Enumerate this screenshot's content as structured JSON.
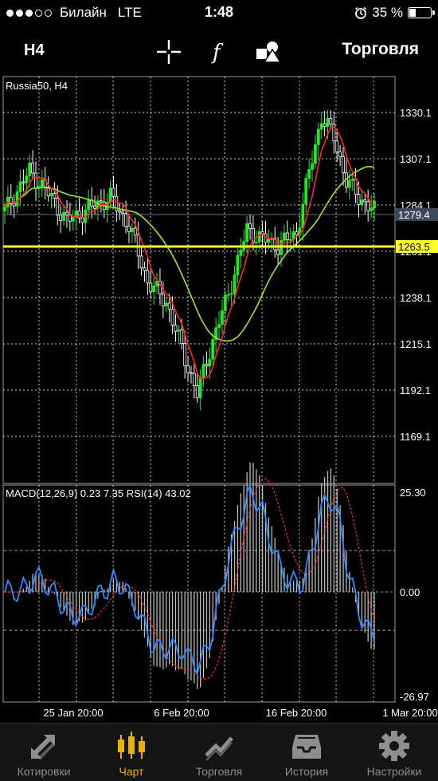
{
  "status_bar": {
    "carrier": "Билайн",
    "network": "LTE",
    "time": "1:48",
    "battery": "35 %",
    "battery_level": 0.35,
    "signal_bars": 3
  },
  "toolbar": {
    "timeframe": "H4",
    "trade_label": "Торговля",
    "icons": [
      "crosshair-icon",
      "function-icon",
      "objects-icon"
    ]
  },
  "chart": {
    "symbol_label": "Russia50, H4",
    "price_labels": [
      "1330.1",
      "1307.1",
      "1284.1",
      "1261.1",
      "1238.1",
      "1215.1",
      "1192.1",
      "1169.1"
    ],
    "current_price": "1279.4",
    "hline_price": "1263.5",
    "indicator_label": "MACD(12,26,9) 0.23 7.35 RSI(14) 43.02",
    "indicator_levels": [
      "25.30",
      "0.00",
      "-26.97"
    ],
    "time_labels": [
      "25 Jan 20:00",
      "6 Feb 20:00",
      "16 Feb 20:00",
      "1 Mar 20:00"
    ],
    "colors": {
      "bull": "#22e822",
      "bear": "#ffffff",
      "fast_ma": "#ff2a1a",
      "slow_ma": "#9ee82a",
      "hline": "#ffff2b",
      "rsi": "#2a8cff",
      "grid": "#ffffff"
    }
  },
  "tabs": [
    {
      "label": "Котировки",
      "icon": "quotes-arrows-icon",
      "active": false
    },
    {
      "label": "Чарт",
      "icon": "candles-icon",
      "active": true
    },
    {
      "label": "Торговля",
      "icon": "trade-chart-icon",
      "active": false
    },
    {
      "label": "История",
      "icon": "history-inbox-icon",
      "active": false
    },
    {
      "label": "Настройки",
      "icon": "gear-icon",
      "active": false
    }
  ]
}
